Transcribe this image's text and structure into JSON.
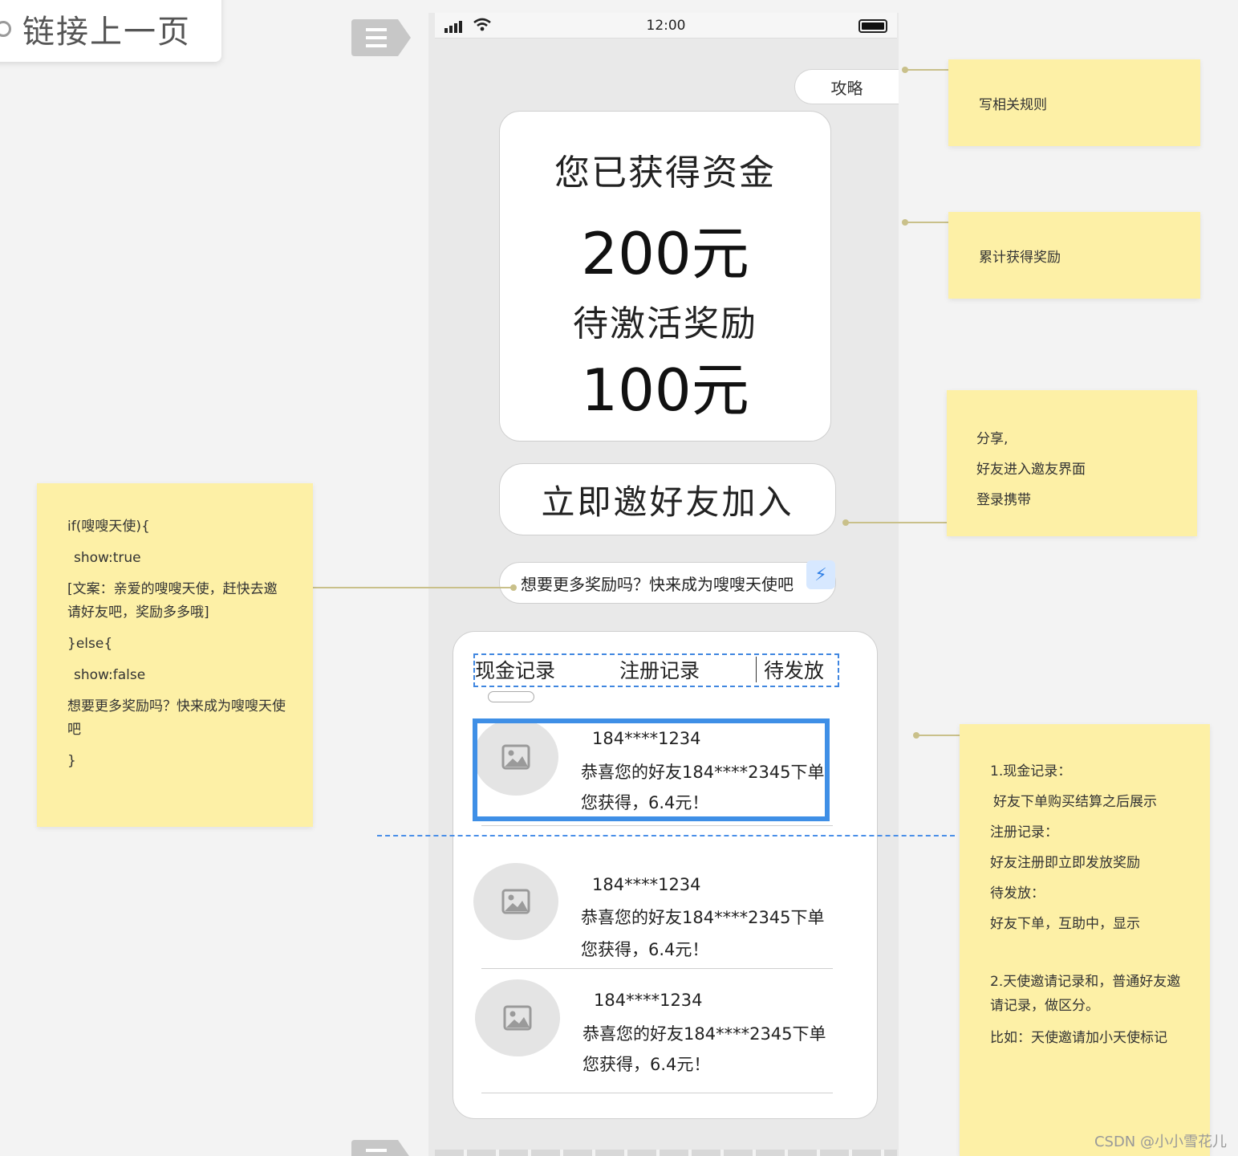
{
  "nav": {
    "back_link_label": "链接上一页"
  },
  "status_bar": {
    "time": "12:00"
  },
  "page": {
    "strategy_label": "攻略",
    "reward": {
      "title": "您已获得资金",
      "amount": "200元",
      "pending_label": "待激活奖励",
      "pending_amount": "100元"
    },
    "invite_button_label": "立即邀好友加入",
    "angel_tip_text": "想要更多奖励吗？快来成为嗖嗖天使吧",
    "tabs": [
      {
        "label": "现金记录"
      },
      {
        "label": "注册记录"
      },
      {
        "label": "待发放"
      }
    ],
    "records": [
      {
        "phone": "184****1234",
        "message": "恭喜您的好友184****2345下单",
        "earned": "您获得，6.4元！"
      },
      {
        "phone": "184****1234",
        "message": "恭喜您的好友184****2345下单",
        "earned": "您获得，6.4元！"
      },
      {
        "phone": "184****1234",
        "message": "恭喜您的好友184****2345下单",
        "earned": "您获得，6.4元！"
      }
    ]
  },
  "notes": {
    "rules": [
      "写相关规则"
    ],
    "total_reward": [
      "累计获得奖励"
    ],
    "share": [
      "分享,",
      "好友进入邀友界面",
      "登录携带"
    ],
    "angel_logic": [
      "if(嗖嗖天使){",
      "  show:true",
      "[文案：亲爱的嗖嗖天使，赶快去邀请好友吧，奖励多多哦]",
      "}else{",
      "  show:false",
      "想要更多奖励吗？快来成为嗖嗖天使吧",
      "}"
    ],
    "records_desc": [
      "1.现金记录：",
      " 好友下单购买结算之后展示",
      "注册记录：",
      "好友注册即立即发放奖励",
      "待发放：",
      "好友下单，互助中，显示",
      "",
      "2.天使邀请记录和，普通好友邀请记录，做区分。",
      "比如：天使邀请加小天使标记"
    ]
  },
  "watermark": "CSDN @小小雪花儿",
  "colors": {
    "sticky": "#fdf0a6",
    "selection": "#3f8fe6",
    "connector": "#c9c08a"
  }
}
